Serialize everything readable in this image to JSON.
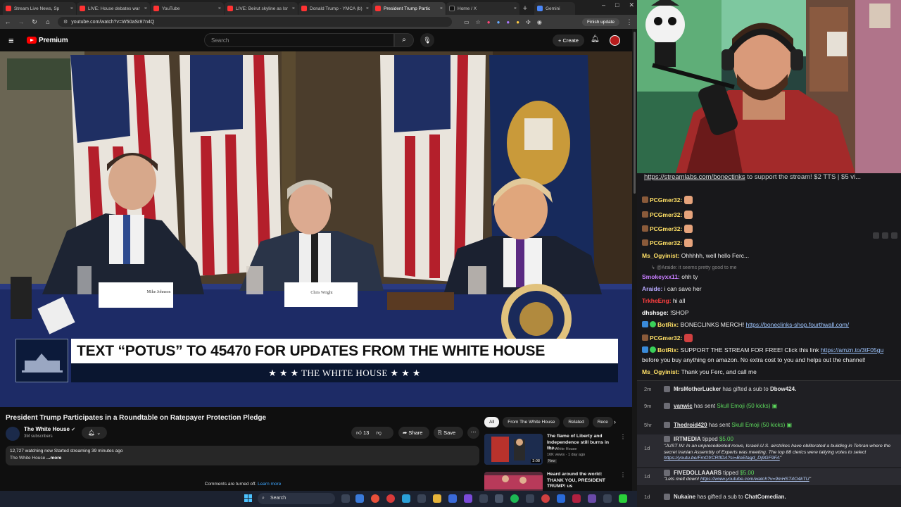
{
  "browser": {
    "tabs": [
      {
        "label": "Stream Live News, Sp",
        "color": "#ff3333"
      },
      {
        "label": "LIVE: House debates war",
        "color": "#ff3333"
      },
      {
        "label": "YouTube",
        "color": "#ff3333"
      },
      {
        "label": "LIVE: Beirut skyline as Isr",
        "color": "#ff3333"
      },
      {
        "label": "Donald Trump - YMCA (b)",
        "color": "#ff3333"
      },
      {
        "label": "President Trump Partic",
        "color": "#ff3333",
        "active": true
      },
      {
        "label": "Home / X",
        "color": "#111111"
      },
      {
        "label": "Gemini",
        "color": "#4a86f7"
      }
    ],
    "url": "youtube.com/watch?v=W50aSr87n4Q",
    "finish_update": "Finish update"
  },
  "youtube": {
    "logo_text": "Premium",
    "search_placeholder": "Search",
    "create_label": "Create",
    "video": {
      "banner_text": "TEXT “POTUS” TO 45470 FOR UPDATES FROM THE WHITE HOUSE",
      "banner_sub": "★ ★ ★  THE WHITE HOUSE  ★ ★ ★",
      "nameplate_left": "Mike Johnson",
      "nameplate_mid": "Chris Wright"
    },
    "title": "President Trump Participates in a Roundtable on Ratepayer Protection Pledge",
    "channel": {
      "name": "The White House",
      "subs": "3M subscribers"
    },
    "likes": "13",
    "share_label": "Share",
    "save_label": "Save",
    "description": {
      "watching": "12,727 watching now  Started streaming 39 minutes ago",
      "channel": "The White House",
      "more": " ...more"
    },
    "comments_off": "Comments are turned off.",
    "learn_more": "Learn more",
    "chips": [
      "All",
      "From The White House",
      "Related",
      "Rece"
    ],
    "recommendations": [
      {
        "title": "The flame of Liberty and Independence still burns in the...",
        "channel": "The White House",
        "meta": "16K views · 1 day ago",
        "badge": "New",
        "duration": "3:08"
      },
      {
        "title": "Heard around the world: THANK YOU, PRESIDENT TRUMP! us",
        "channel": "",
        "meta": "",
        "badge": "",
        "duration": ""
      }
    ]
  },
  "taskbar": {
    "search": "Search"
  },
  "chat": {
    "link_line_url": "https://streamlabs.com/bonectinks",
    "link_line_rest": " to support the stream! $2 TTS | $5 vi...",
    "messages": [
      {
        "user": "PCGmer32:",
        "text": "",
        "color": "#ffe066",
        "emote": true
      },
      {
        "user": "PCGmer32:",
        "text": "",
        "color": "#ffe066",
        "emote": true
      },
      {
        "user": "PCGmer32:",
        "text": "",
        "color": "#ffe066",
        "emote": true
      },
      {
        "user": "PCGmer32:",
        "text": "",
        "color": "#ffe066",
        "emote": true
      },
      {
        "user": "Ms_Ogyinist:",
        "text": " Ohhhhh, well hello Ferc...",
        "color": "#ffe066"
      },
      {
        "user": "",
        "text": "@Araide: it seems pretty good to me",
        "color": "#888888",
        "reply": true
      },
      {
        "user": "Smokeyxx11:",
        "text": " ohh ty",
        "color": "#c77dff"
      },
      {
        "user": "Araide:",
        "text": " i can save her",
        "color": "#b8a9ff"
      },
      {
        "user": "TrkheEng:",
        "text": " hi all",
        "color": "#ff4040"
      },
      {
        "user": "dhshsge:",
        "text": " !SHOP",
        "color": "#ffffff"
      },
      {
        "user": "BotRix:",
        "text": " BONECLINKS MERCH! ",
        "link": "https://boneclinks-shop.fourthwall.com/",
        "color": "#ffe066",
        "bot": true
      },
      {
        "user": "PCGmer32:",
        "text": "",
        "color": "#ffe066",
        "emote": true
      },
      {
        "user": "BotRix:",
        "text": " SUPPORT THE STREAM FOR FREE! Click this link ",
        "link": "https://amzn.to/3tF05gu",
        "color": "#ffe066",
        "bot": true
      },
      {
        "user": "",
        "text": "before you buy anything on amazon. No extra cost to you and helps out the channel!",
        "color": "#eeeeee"
      },
      {
        "user": "Ms_Ogyinist:",
        "text": " Thank you Ferc, and call me",
        "color": "#ffe066"
      }
    ],
    "events": [
      {
        "time": "2m",
        "user": "MrsMotherLucker",
        "text": " has gifted a sub to ",
        "target": "Dbow424."
      },
      {
        "time": "9m",
        "user": "vanwic",
        "text": " has sent ",
        "item": "Skull Emoji (50 kicks)"
      },
      {
        "time": "5hr",
        "user": "Thedroid420",
        "text": " has sent ",
        "item": "Skull Emoji (50 kicks)"
      },
      {
        "time": "1d",
        "user": "IRTMEDIA",
        "text": " tipped ",
        "amount": "$5.00",
        "message": "\"JUST IN: In an unprecedented move, Israeli-U.S. airstrikes have obliterated a building in Tehran where the secret Iranian Assembly of Experts was meeting. The top 88 clerics were tallying votes to select ",
        "message_link": "https://youtu.be/FmOfrCRfIDA?si=BoEtagd_Dj9GF9FA",
        "message_end": "\""
      },
      {
        "time": "1d",
        "user": "FIVEDOLLAAARS",
        "text": " tipped ",
        "amount": "$5.00",
        "message": "\"Lets melt down! ",
        "message_link": "https://www.youtube.com/watch?v=9mHST4O4kTU",
        "message_end": "\""
      },
      {
        "time": "1d",
        "user": "Nukaine",
        "text": " has gifted a sub to ",
        "target": "ChatComedian."
      }
    ]
  }
}
